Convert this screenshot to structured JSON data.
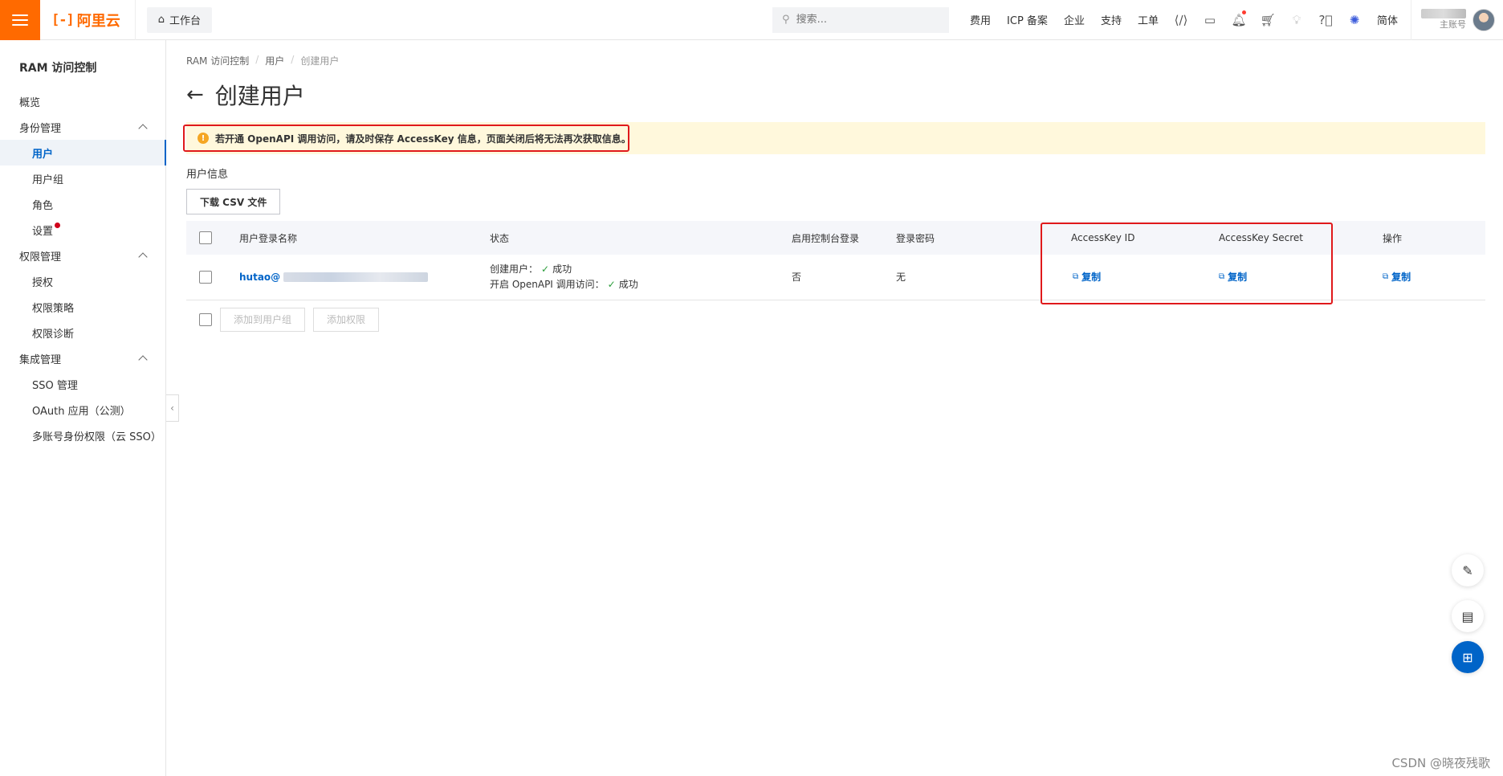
{
  "topbar": {
    "logo_text": "阿里云",
    "logo_mark": "[-]",
    "workbench": "工作台",
    "search_placeholder": "搜索...",
    "links": [
      "费用",
      "ICP 备案",
      "企业",
      "支持",
      "工单"
    ],
    "lang": "简体",
    "account_role": "主账号"
  },
  "sidebar": {
    "title": "RAM 访问控制",
    "overview": "概览",
    "identity": {
      "label": "身份管理",
      "items": [
        "用户",
        "用户组",
        "角色",
        "设置"
      ]
    },
    "permission": {
      "label": "权限管理",
      "items": [
        "授权",
        "权限策略",
        "权限诊断"
      ]
    },
    "integration": {
      "label": "集成管理",
      "items": [
        "SSO 管理",
        "OAuth 应用（公测）",
        "多账号身份权限（云 SSO）"
      ]
    }
  },
  "breadcrumb": [
    "RAM 访问控制",
    "用户",
    "创建用户"
  ],
  "page_title": "创建用户",
  "alert_text": "若开通 OpenAPI 调用访问，请及时保存 AccessKey 信息，页面关闭后将无法再次获取信息。",
  "section_label": "用户信息",
  "csv_button": "下载 CSV 文件",
  "table": {
    "headers": [
      "用户登录名称",
      "状态",
      "启用控制台登录",
      "登录密码",
      "AccessKey ID",
      "AccessKey Secret",
      "操作"
    ],
    "row": {
      "login_name": "hutao@",
      "status_create_label": "创建用户：",
      "status_openapi_label": "开启 OpenAPI 调用访问：",
      "status_success": "成功",
      "console_login": "否",
      "password": "无",
      "copy_label": "复制"
    }
  },
  "footer_buttons": [
    "添加到用户组",
    "添加权限"
  ],
  "watermark": "CSDN @晓夜残歌",
  "colors": {
    "brand": "#ff6a00",
    "link": "#0064c8",
    "highlight": "#e0191b",
    "alert_bg": "#fff8dc"
  }
}
